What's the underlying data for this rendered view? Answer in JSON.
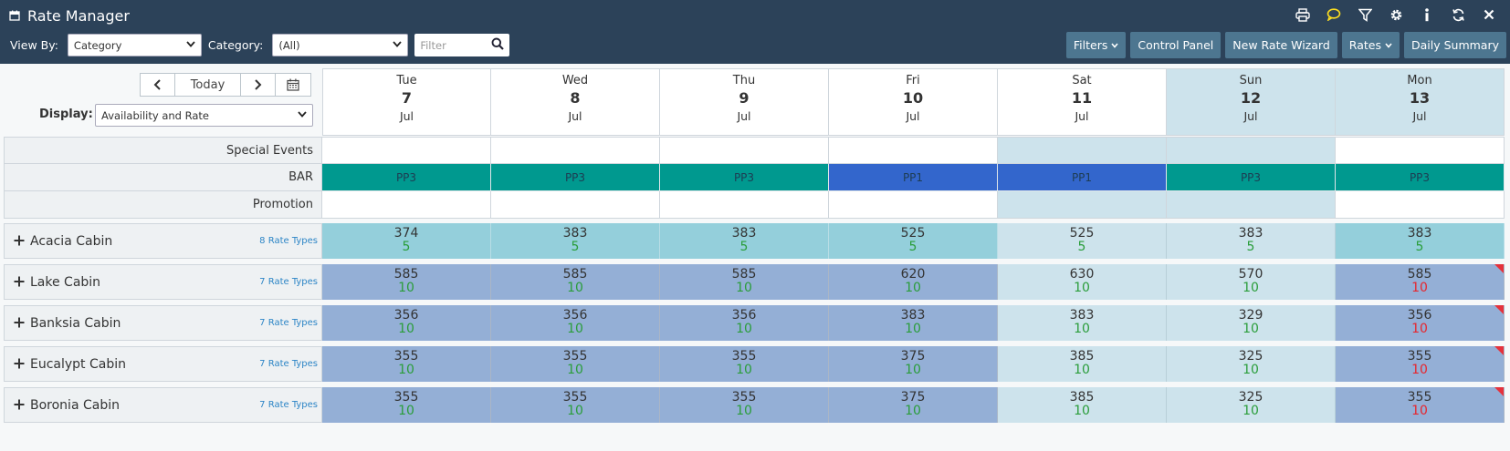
{
  "app": {
    "title": "Rate Manager"
  },
  "toolbar": {
    "view_by_label": "View By:",
    "view_by_value": "Category",
    "category_label": "Category:",
    "category_value": "(All)",
    "filter_placeholder": "Filter",
    "buttons": {
      "filters": "Filters",
      "control_panel": "Control Panel",
      "new_rate_wizard": "New Rate Wizard",
      "rates": "Rates",
      "daily_summary": "Daily Summary"
    }
  },
  "date_nav": {
    "today_label": "Today"
  },
  "display": {
    "label": "Display:",
    "value": "Availability and Rate"
  },
  "days": [
    {
      "name": "Tue",
      "date": "7",
      "month": "Jul",
      "weekend": false
    },
    {
      "name": "Wed",
      "date": "8",
      "month": "Jul",
      "weekend": false
    },
    {
      "name": "Thu",
      "date": "9",
      "month": "Jul",
      "weekend": false
    },
    {
      "name": "Fri",
      "date": "10",
      "month": "Jul",
      "weekend": false
    },
    {
      "name": "Sat",
      "date": "11",
      "month": "Jul",
      "weekend": false
    },
    {
      "name": "Sun",
      "date": "12",
      "month": "Jul",
      "weekend": true
    },
    {
      "name": "Mon",
      "date": "13",
      "month": "Jul",
      "weekend": true
    }
  ],
  "info_rows": {
    "special_events": "Special Events",
    "bar": "BAR",
    "promotion": "Promotion"
  },
  "bar_codes": [
    "PP3",
    "PP3",
    "PP3",
    "PP1",
    "PP1",
    "PP3",
    "PP3"
  ],
  "rooms": [
    {
      "name": "Acacia Cabin",
      "rate_types": "8 Rate Types",
      "cells": [
        {
          "rate": "374",
          "avail": "5"
        },
        {
          "rate": "383",
          "avail": "5"
        },
        {
          "rate": "383",
          "avail": "5"
        },
        {
          "rate": "525",
          "avail": "5"
        },
        {
          "rate": "525",
          "avail": "5"
        },
        {
          "rate": "383",
          "avail": "5"
        },
        {
          "rate": "383",
          "avail": "5"
        }
      ]
    },
    {
      "name": "Lake Cabin",
      "rate_types": "7 Rate Types",
      "cells": [
        {
          "rate": "585",
          "avail": "10"
        },
        {
          "rate": "585",
          "avail": "10"
        },
        {
          "rate": "585",
          "avail": "10"
        },
        {
          "rate": "620",
          "avail": "10"
        },
        {
          "rate": "630",
          "avail": "10"
        },
        {
          "rate": "570",
          "avail": "10"
        },
        {
          "rate": "585",
          "avail": "10"
        }
      ]
    },
    {
      "name": "Banksia Cabin",
      "rate_types": "7 Rate Types",
      "cells": [
        {
          "rate": "356",
          "avail": "10"
        },
        {
          "rate": "356",
          "avail": "10"
        },
        {
          "rate": "356",
          "avail": "10"
        },
        {
          "rate": "383",
          "avail": "10"
        },
        {
          "rate": "383",
          "avail": "10"
        },
        {
          "rate": "329",
          "avail": "10"
        },
        {
          "rate": "356",
          "avail": "10"
        }
      ]
    },
    {
      "name": "Eucalypt Cabin",
      "rate_types": "7 Rate Types",
      "cells": [
        {
          "rate": "355",
          "avail": "10"
        },
        {
          "rate": "355",
          "avail": "10"
        },
        {
          "rate": "355",
          "avail": "10"
        },
        {
          "rate": "375",
          "avail": "10"
        },
        {
          "rate": "385",
          "avail": "10"
        },
        {
          "rate": "325",
          "avail": "10"
        },
        {
          "rate": "355",
          "avail": "10"
        }
      ]
    },
    {
      "name": "Boronia Cabin",
      "rate_types": "7 Rate Types",
      "cells": [
        {
          "rate": "355",
          "avail": "10"
        },
        {
          "rate": "355",
          "avail": "10"
        },
        {
          "rate": "355",
          "avail": "10"
        },
        {
          "rate": "375",
          "avail": "10"
        },
        {
          "rate": "385",
          "avail": "10"
        },
        {
          "rate": "325",
          "avail": "10"
        },
        {
          "rate": "355",
          "avail": "10"
        }
      ]
    }
  ],
  "colors": {
    "header_bg": "#2c4259",
    "button_bg": "#4d7690",
    "bar_pp3": "#00998f",
    "bar_pp1": "#3366cc",
    "weekend_bg": "#cde3ec",
    "cell_teal": "#94cfdb",
    "cell_blue": "#94afd6",
    "avail_green": "#2a9d3a",
    "avail_red": "#e6262e",
    "link_blue": "#2c85c6"
  },
  "icons": [
    "calendar-icon",
    "print-icon",
    "chat-icon",
    "funnel-icon",
    "gear-icon",
    "info-icon",
    "refresh-icon",
    "close-icon",
    "search-icon",
    "chevron-left-icon",
    "chevron-right-icon",
    "plus-icon"
  ]
}
